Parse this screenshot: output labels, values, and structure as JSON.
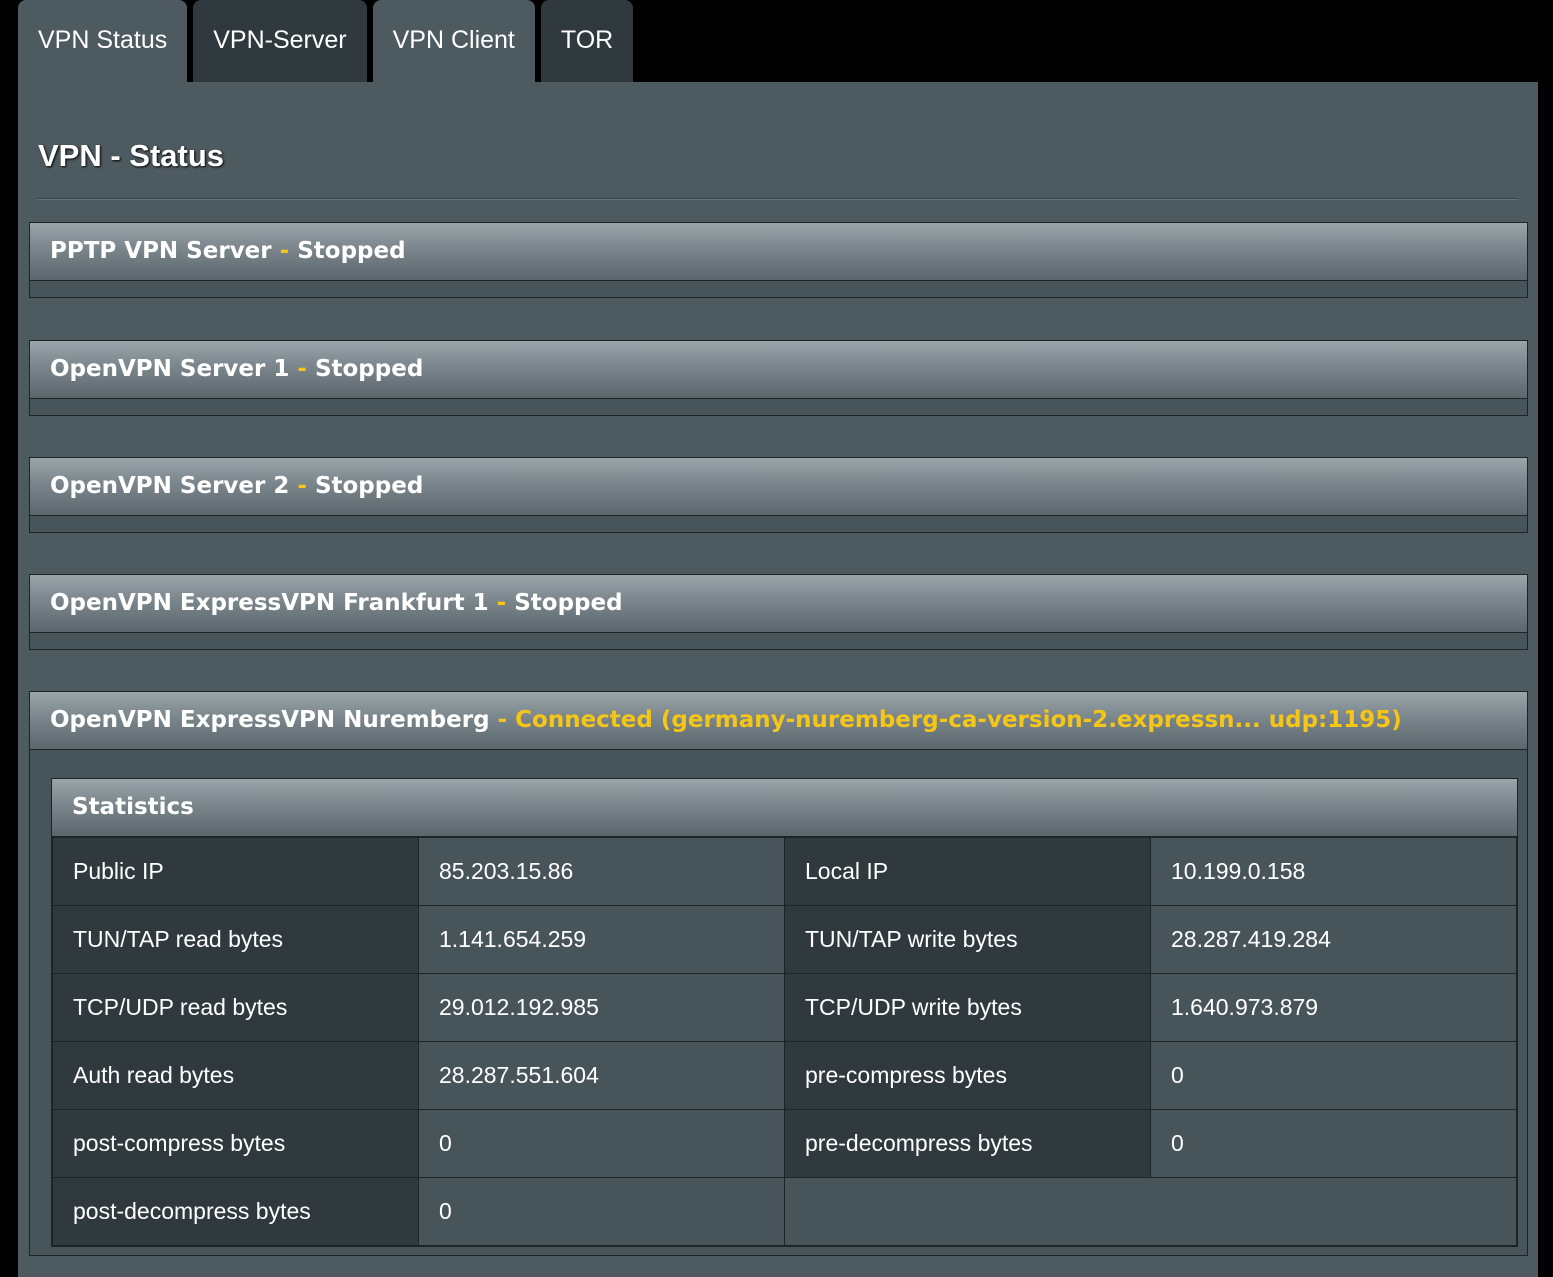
{
  "tabs": [
    {
      "label": "VPN Status",
      "style": "light"
    },
    {
      "label": "VPN-Server",
      "style": "dark"
    },
    {
      "label": "VPN Client",
      "style": "light"
    },
    {
      "label": "TOR",
      "style": "dark"
    }
  ],
  "page_title": "VPN - Status",
  "separator": "-",
  "sections": [
    {
      "name": "PPTP VPN Server",
      "status": "Stopped"
    },
    {
      "name": "OpenVPN Server 1",
      "status": "Stopped"
    },
    {
      "name": "OpenVPN Server 2",
      "status": "Stopped"
    },
    {
      "name": "OpenVPN ExpressVPN Frankfurt 1",
      "status": "Stopped"
    },
    {
      "name": "OpenVPN ExpressVPN Nuremberg",
      "status": "Connected (germany-nuremberg-ca-version-2.expressn... udp:1195)"
    }
  ],
  "statistics": {
    "title": "Statistics",
    "rows": [
      [
        {
          "label": "Public IP",
          "value": "85.203.15.86"
        },
        {
          "label": "Local IP",
          "value": "10.199.0.158"
        }
      ],
      [
        {
          "label": "TUN/TAP read bytes",
          "value": "1.141.654.259"
        },
        {
          "label": "TUN/TAP write bytes",
          "value": "28.287.419.284"
        }
      ],
      [
        {
          "label": "TCP/UDP read bytes",
          "value": "29.012.192.985"
        },
        {
          "label": "TCP/UDP write bytes",
          "value": "1.640.973.879"
        }
      ],
      [
        {
          "label": "Auth read bytes",
          "value": "28.287.551.604"
        },
        {
          "label": "pre-compress bytes",
          "value": "0"
        }
      ],
      [
        {
          "label": "post-compress bytes",
          "value": "0"
        },
        {
          "label": "pre-decompress bytes",
          "value": "0"
        }
      ],
      [
        {
          "label": "post-decompress bytes",
          "value": "0"
        }
      ]
    ]
  }
}
